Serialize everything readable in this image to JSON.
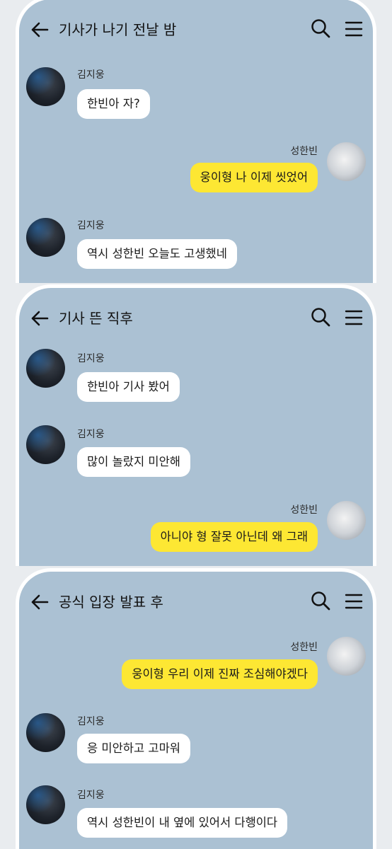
{
  "panels": [
    {
      "title": "기사가 나기 전날 밤",
      "messages": [
        {
          "sender": "김지웅",
          "text": "한빈아 자?"
        },
        {
          "sender": "성한빈",
          "text": "웅이형 나 이제 씻었어"
        },
        {
          "sender": "김지웅",
          "text": "역시 성한빈 오늘도 고생했네"
        }
      ]
    },
    {
      "title": "기사 뜬 직후",
      "messages": [
        {
          "sender": "김지웅",
          "text": "한빈아 기사 봤어"
        },
        {
          "sender": "김지웅",
          "text": "많이 놀랐지 미안해"
        },
        {
          "sender": "성한빈",
          "text": "아니야 형 잘못 아닌데 왜 그래"
        }
      ]
    },
    {
      "title": "공식 입장 발표 후",
      "messages": [
        {
          "sender": "성한빈",
          "text": "웅이형 우리 이제 진짜 조심해야겠다"
        },
        {
          "sender": "김지웅",
          "text": "응 미안하고 고마워"
        },
        {
          "sender": "김지웅",
          "text": "역시 성한빈이 내 옆에 있어서 다행이다"
        }
      ]
    }
  ],
  "colors": {
    "chat_background": "#abc1d3",
    "my_bubble": "#fde733",
    "other_bubble": "#ffffff"
  },
  "icons": {
    "back": "back-arrow-icon",
    "search": "search-icon",
    "menu": "menu-icon",
    "avatar": "profile-photo"
  }
}
